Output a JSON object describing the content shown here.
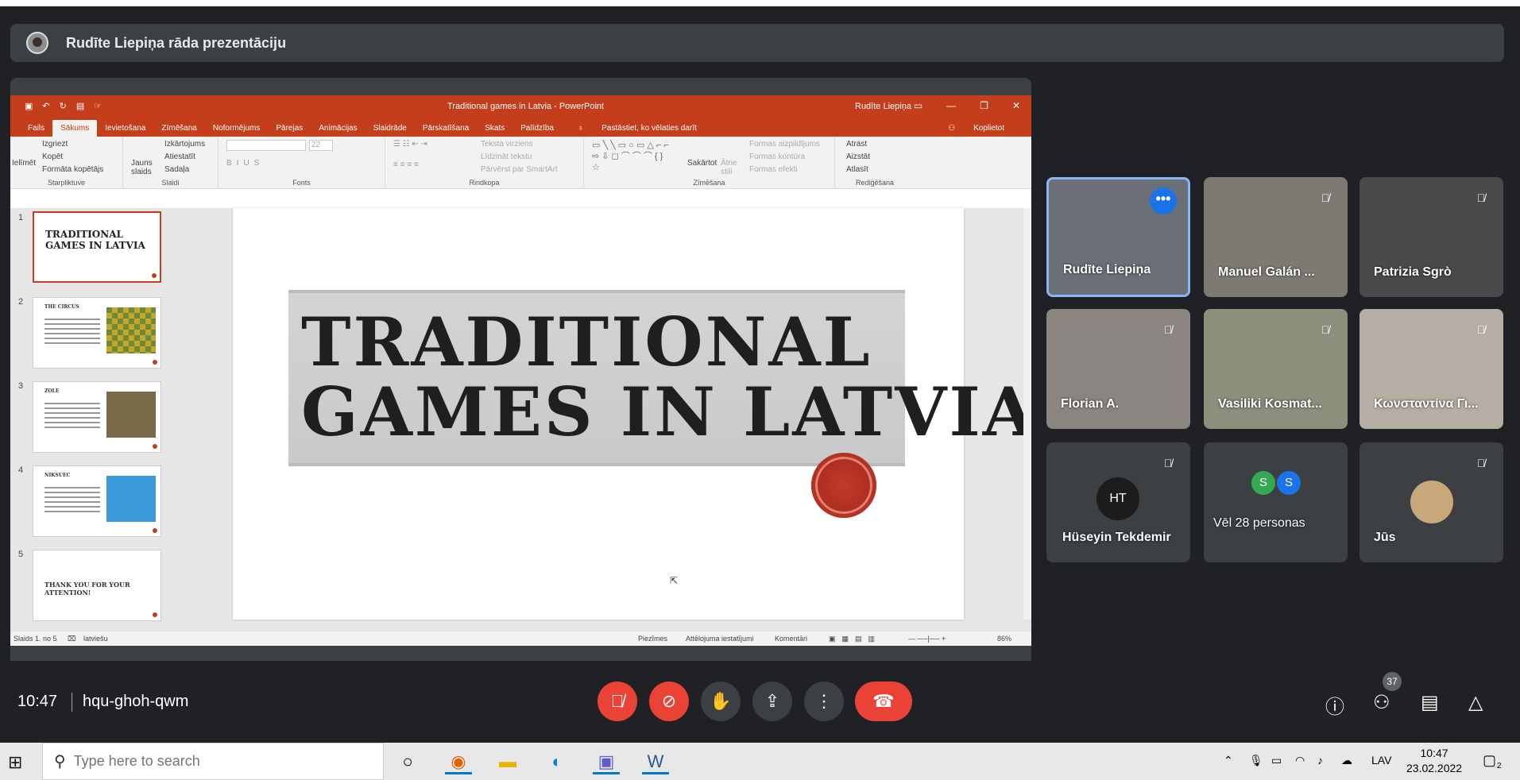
{
  "banner": {
    "presenter_text": "Rudīte Liepiņa rāda prezentāciju"
  },
  "powerpoint": {
    "window_title": "Traditional games in Latvia  -  PowerPoint",
    "user": "Rudīte Liepiņa",
    "tabs": [
      "Fails",
      "Sākums",
      "Ievietošana",
      "Zīmēšana",
      "Noformējums",
      "Pārejas",
      "Animācijas",
      "Slaidrāde",
      "Pārskatīšana",
      "Skats",
      "Palīdzība"
    ],
    "tell_me": "Pastāstiet, ko vēlaties darīt",
    "share": "Koplietot",
    "ribbon": {
      "clipboard": {
        "paste": "Ielīmēt",
        "cut": "Izgriezt",
        "copy": "Kopēt",
        "format_painter": "Formāta kopētājs",
        "label": "Starpliktuve"
      },
      "slides": {
        "new": "Jauns slaids",
        "layout": "Izkārtojums",
        "reset": "Atiestatīt",
        "section": "Sadaļa",
        "label": "Slaidi"
      },
      "font": {
        "size": "22",
        "label": "Fonts"
      },
      "paragraph": {
        "direction": "Teksta virziens",
        "align": "Līdzināt tekstu",
        "smartart": "Pārvērst par SmartArt",
        "label": "Rindkopa"
      },
      "drawing": {
        "arrange": "Sakārtot",
        "styles": "Ātrie stili",
        "fill": "Formas aizpildījums",
        "outline": "Formas kontūra",
        "effects": "Formas efekti",
        "label": "Zīmēšana"
      },
      "editing": {
        "find": "Atrast",
        "replace": "Aizstāt",
        "select": "Atlasīt",
        "label": "Rediģēšana"
      }
    },
    "thumbnails": [
      {
        "num": "1",
        "title": "TRADITIONAL GAMES IN LATVIA"
      },
      {
        "num": "2",
        "title": "THE CIRCUS"
      },
      {
        "num": "3",
        "title": "ZOLE"
      },
      {
        "num": "4",
        "title": "NIKSUEC"
      },
      {
        "num": "5",
        "title": "THANK YOU FOR YOUR ATTENTION!"
      }
    ],
    "slide_title_line1": "TRADITIONAL",
    "slide_title_line2": "GAMES IN LATVIA",
    "status": {
      "slide": "Slaids 1. no 5",
      "lang": "latviešu",
      "notes": "Piezīmes",
      "display": "Attēlojuma iestatījumi",
      "comments": "Komentāri",
      "zoom": "86%"
    }
  },
  "participants": [
    {
      "name": "Rudīte Liepiņa",
      "selected": true
    },
    {
      "name": "Manuel Galán ...",
      "muted": true
    },
    {
      "name": "Patrizia Sgrò",
      "muted": true
    },
    {
      "name": "Florian A.",
      "muted": true
    },
    {
      "name": "Vasiliki Kosmat...",
      "muted": true
    },
    {
      "name": "Κωνσταντίνα Γι...",
      "muted": true
    },
    {
      "name": "Hüseyin Tekdemir",
      "initials": "HT",
      "muted": true
    },
    {
      "name": "Vēl 28 personas",
      "avatars": [
        "S",
        "S"
      ]
    },
    {
      "name": "Jūs",
      "muted": true
    }
  ],
  "meeting": {
    "time": "10:47",
    "code": "hqu-ghoh-qwm",
    "people_count": "37"
  },
  "taskbar": {
    "search_placeholder": "Type here to search",
    "lang": "LAV",
    "time": "10:47",
    "date": "23.02.2022",
    "notifications": "2"
  }
}
